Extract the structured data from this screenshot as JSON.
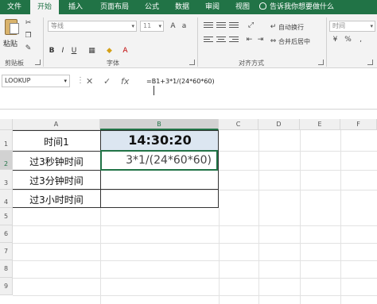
{
  "ribbon_tabs": [
    {
      "label": "文件",
      "active": false
    },
    {
      "label": "开始",
      "active": true
    },
    {
      "label": "插入",
      "active": false
    },
    {
      "label": "页面布局",
      "active": false
    },
    {
      "label": "公式",
      "active": false
    },
    {
      "label": "数据",
      "active": false
    },
    {
      "label": "审阅",
      "active": false
    },
    {
      "label": "视图",
      "active": false
    }
  ],
  "tell_me": "告诉我你想要做什么",
  "clipboard": {
    "paste": "粘贴",
    "group": "剪贴板"
  },
  "font_group": {
    "font_name": "等线",
    "font_size": "11",
    "bold": "B",
    "italic": "I",
    "underline": "U",
    "group": "字体"
  },
  "align_group": {
    "wrap": "自动换行",
    "merge": "合并后居中",
    "group": "对齐方式"
  },
  "number_group": {
    "format": "时间"
  },
  "formula_bar": {
    "name_box": "LOOKUP",
    "formula": "=B1+3*1/(24*60*60)",
    "cancel": "✕",
    "enter": "✓",
    "fx": "fx"
  },
  "columns": [
    "A",
    "B",
    "C",
    "D",
    "E",
    "F"
  ],
  "rows": [
    "1",
    "2",
    "3",
    "4",
    "5",
    "6",
    "7",
    "8",
    "9"
  ],
  "cells": {
    "A1": "时间1",
    "A2": "过3秒钟时间",
    "A3": "过3分钟时间",
    "A4": "过3小时时间",
    "B1": "14:30:20",
    "B2_editing": "3*1/(24*60*60)"
  },
  "colors": {
    "accent": "#217346",
    "header_fill": "#dce6f1"
  }
}
